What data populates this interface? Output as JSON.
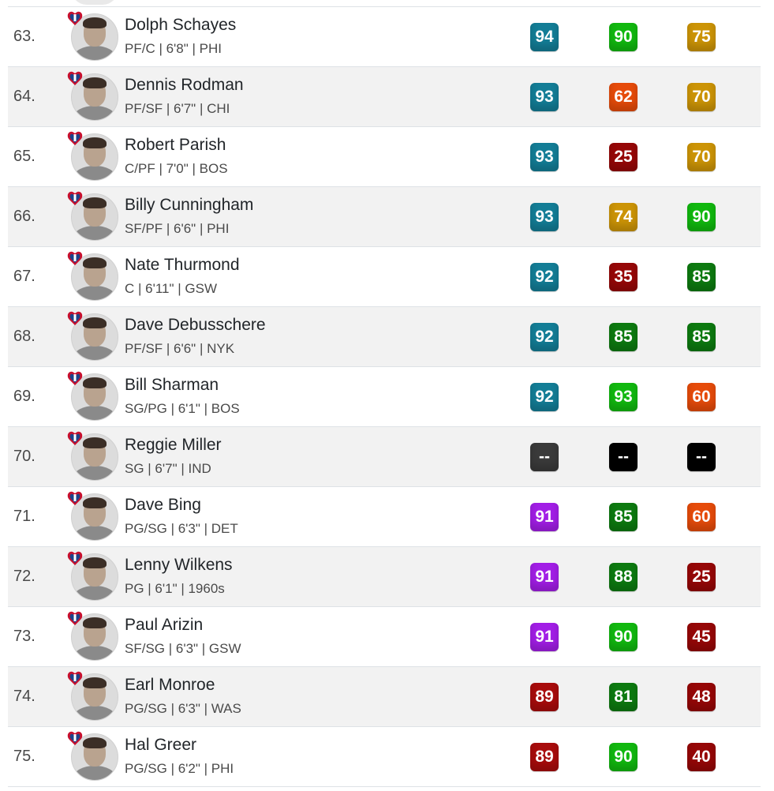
{
  "colors": {
    "blue": "#137d96",
    "purple": "#a21ee6",
    "red": "#a80c0c",
    "bright_green": "#11b80f",
    "dark_green": "#0d7a10",
    "orange": "#e64b0a",
    "dark_red": "#960707",
    "gold": "#cc9406",
    "dark_gray": "#3a3a3a",
    "black": "#000000"
  },
  "icons": {
    "badge": "nba-75th-anniversary-logo-icon",
    "avatar": "player-headshot"
  },
  "players": [
    {
      "rank": "63.",
      "name": "Dolph Schayes",
      "meta": "PF/C | 6'8\" | PHI",
      "ratings": [
        {
          "value": "94",
          "color": "#137d96"
        },
        {
          "value": "90",
          "color": "#11b80f"
        },
        {
          "value": "75",
          "color": "#cc9406"
        }
      ]
    },
    {
      "rank": "64.",
      "name": "Dennis Rodman",
      "meta": "PF/SF | 6'7\" | CHI",
      "ratings": [
        {
          "value": "93",
          "color": "#137d96"
        },
        {
          "value": "62",
          "color": "#e64b0a"
        },
        {
          "value": "70",
          "color": "#cc9406"
        }
      ]
    },
    {
      "rank": "65.",
      "name": "Robert Parish",
      "meta": "C/PF | 7'0\" | BOS",
      "ratings": [
        {
          "value": "93",
          "color": "#137d96"
        },
        {
          "value": "25",
          "color": "#960707"
        },
        {
          "value": "70",
          "color": "#cc9406"
        }
      ]
    },
    {
      "rank": "66.",
      "name": "Billy Cunningham",
      "meta": "SF/PF | 6'6\" | PHI",
      "ratings": [
        {
          "value": "93",
          "color": "#137d96"
        },
        {
          "value": "74",
          "color": "#cc9406"
        },
        {
          "value": "90",
          "color": "#11b80f"
        }
      ]
    },
    {
      "rank": "67.",
      "name": "Nate Thurmond",
      "meta": "C | 6'11\" | GSW",
      "ratings": [
        {
          "value": "92",
          "color": "#137d96"
        },
        {
          "value": "35",
          "color": "#960707"
        },
        {
          "value": "85",
          "color": "#0d7a10"
        }
      ]
    },
    {
      "rank": "68.",
      "name": "Dave Debusschere",
      "meta": "PF/SF | 6'6\" | NYK",
      "ratings": [
        {
          "value": "92",
          "color": "#137d96"
        },
        {
          "value": "85",
          "color": "#0d7a10"
        },
        {
          "value": "85",
          "color": "#0d7a10"
        }
      ]
    },
    {
      "rank": "69.",
      "name": "Bill Sharman",
      "meta": "SG/PG | 6'1\" | BOS",
      "ratings": [
        {
          "value": "92",
          "color": "#137d96"
        },
        {
          "value": "93",
          "color": "#11b80f"
        },
        {
          "value": "60",
          "color": "#e64b0a"
        }
      ]
    },
    {
      "rank": "70.",
      "name": "Reggie Miller",
      "meta": "SG | 6'7\" | IND",
      "ratings": [
        {
          "value": "--",
          "color": "#3a3a3a"
        },
        {
          "value": "--",
          "color": "#000000"
        },
        {
          "value": "--",
          "color": "#000000"
        }
      ]
    },
    {
      "rank": "71.",
      "name": "Dave Bing",
      "meta": "PG/SG | 6'3\" | DET",
      "ratings": [
        {
          "value": "91",
          "color": "#a21ee6"
        },
        {
          "value": "85",
          "color": "#0d7a10"
        },
        {
          "value": "60",
          "color": "#e64b0a"
        }
      ]
    },
    {
      "rank": "72.",
      "name": "Lenny Wilkens",
      "meta": "PG | 6'1\" | 1960s",
      "ratings": [
        {
          "value": "91",
          "color": "#a21ee6"
        },
        {
          "value": "88",
          "color": "#0d7a10"
        },
        {
          "value": "25",
          "color": "#960707"
        }
      ]
    },
    {
      "rank": "73.",
      "name": "Paul Arizin",
      "meta": "SF/SG | 6'3\" | GSW",
      "ratings": [
        {
          "value": "91",
          "color": "#a21ee6"
        },
        {
          "value": "90",
          "color": "#11b80f"
        },
        {
          "value": "45",
          "color": "#960707"
        }
      ]
    },
    {
      "rank": "74.",
      "name": "Earl Monroe",
      "meta": "PG/SG | 6'3\" | WAS",
      "ratings": [
        {
          "value": "89",
          "color": "#a80c0c"
        },
        {
          "value": "81",
          "color": "#0d7a10"
        },
        {
          "value": "48",
          "color": "#960707"
        }
      ]
    },
    {
      "rank": "75.",
      "name": "Hal Greer",
      "meta": "PG/SG | 6'2\" | PHI",
      "ratings": [
        {
          "value": "89",
          "color": "#a80c0c"
        },
        {
          "value": "90",
          "color": "#11b80f"
        },
        {
          "value": "40",
          "color": "#960707"
        }
      ]
    }
  ]
}
